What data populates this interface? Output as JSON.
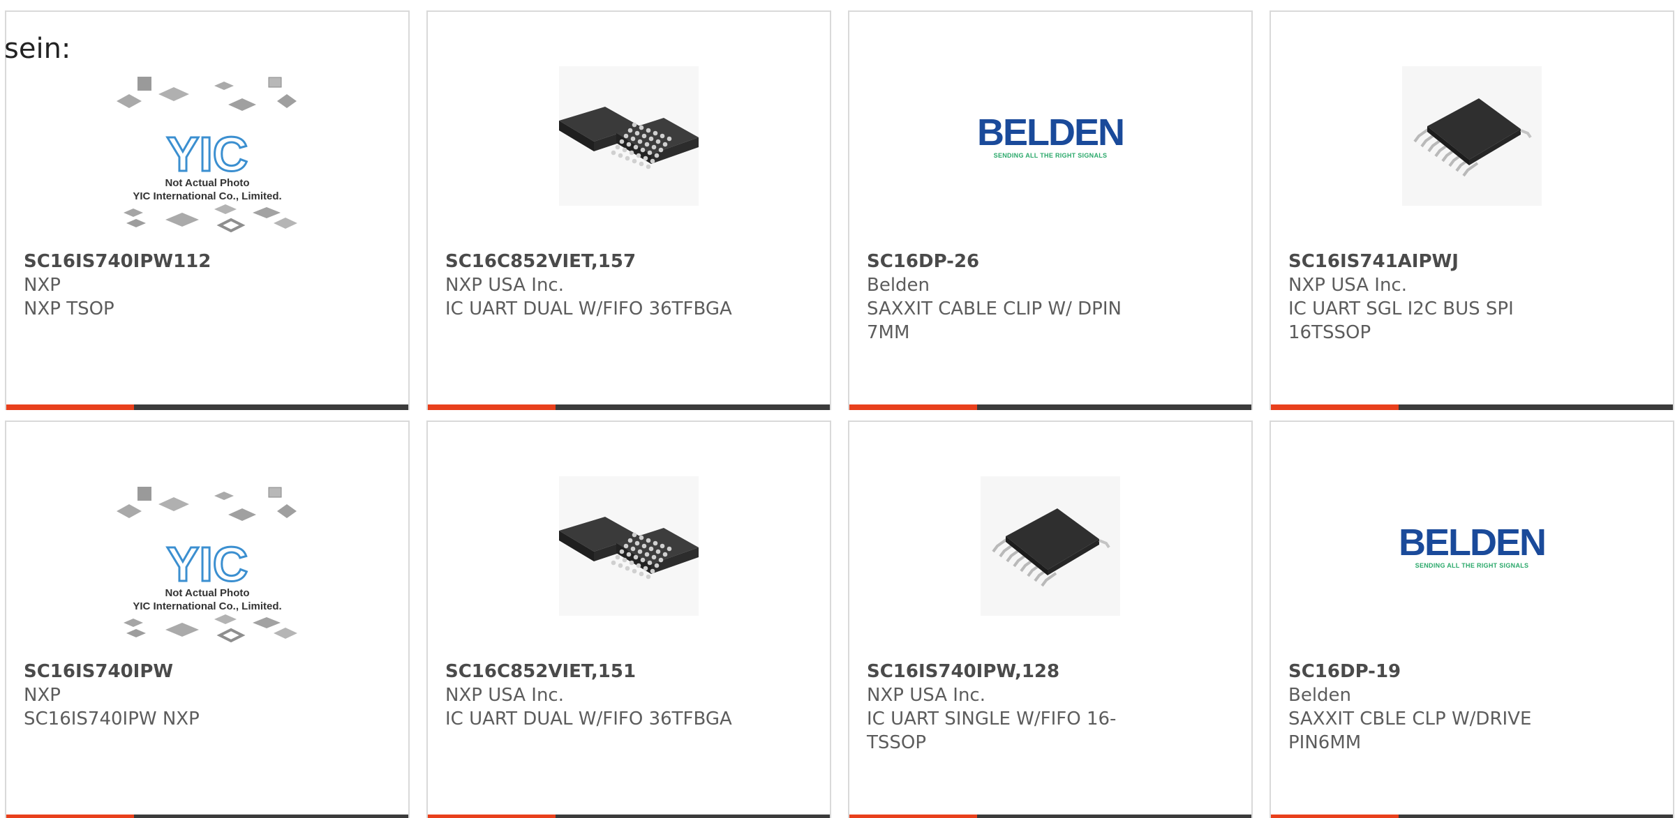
{
  "header_fragment": "sein:",
  "colors": {
    "accent": "#e8401c",
    "bar": "#3b3b3b",
    "belden_blue": "#1a4a9a",
    "belden_green": "#2aa86a",
    "yic_blue": "#3b8fd0"
  },
  "yic_note": {
    "line1": "Not Actual Photo",
    "line2": "YIC International Co., Limited.",
    "logo_text": "YIC"
  },
  "belden_logo": {
    "word": "BELDEN",
    "tagline": "SENDING ALL THE RIGHT SIGNALS"
  },
  "products": [
    {
      "part_number": "SC16IS740IPW112",
      "manufacturer": "NXP",
      "desc_lines": [
        "NXP TSOP"
      ],
      "image": "yic-placeholder"
    },
    {
      "part_number": "SC16C852VIET,157",
      "manufacturer": "NXP USA Inc.",
      "desc_lines": [
        "IC UART DUAL W/FIFO 36TFBGA"
      ],
      "image": "bga-chip"
    },
    {
      "part_number": "SC16DP-26",
      "manufacturer": "Belden",
      "desc_lines": [
        "SAXXIT CABLE CLIP W/ DPIN",
        "7MM"
      ],
      "image": "belden-logo"
    },
    {
      "part_number": "SC16IS741AIPWJ",
      "manufacturer": "NXP USA Inc.",
      "desc_lines": [
        "IC UART SGL I2C BUS SPI",
        "16TSSOP"
      ],
      "image": "tssop-chip"
    },
    {
      "part_number": "SC16IS740IPW",
      "manufacturer": "NXP",
      "desc_lines": [
        "SC16IS740IPW NXP"
      ],
      "image": "yic-placeholder"
    },
    {
      "part_number": "SC16C852VIET,151",
      "manufacturer": "NXP USA Inc.",
      "desc_lines": [
        "IC UART DUAL W/FIFO 36TFBGA"
      ],
      "image": "bga-chip"
    },
    {
      "part_number": "SC16IS740IPW,128",
      "manufacturer": "NXP USA Inc.",
      "desc_lines": [
        "IC UART SINGLE W/FIFO 16-",
        "TSSOP"
      ],
      "image": "tssop-chip"
    },
    {
      "part_number": "SC16DP-19",
      "manufacturer": "Belden",
      "desc_lines": [
        "SAXXIT CBLE CLP W/DRIVE",
        "PIN6MM"
      ],
      "image": "belden-logo"
    }
  ]
}
